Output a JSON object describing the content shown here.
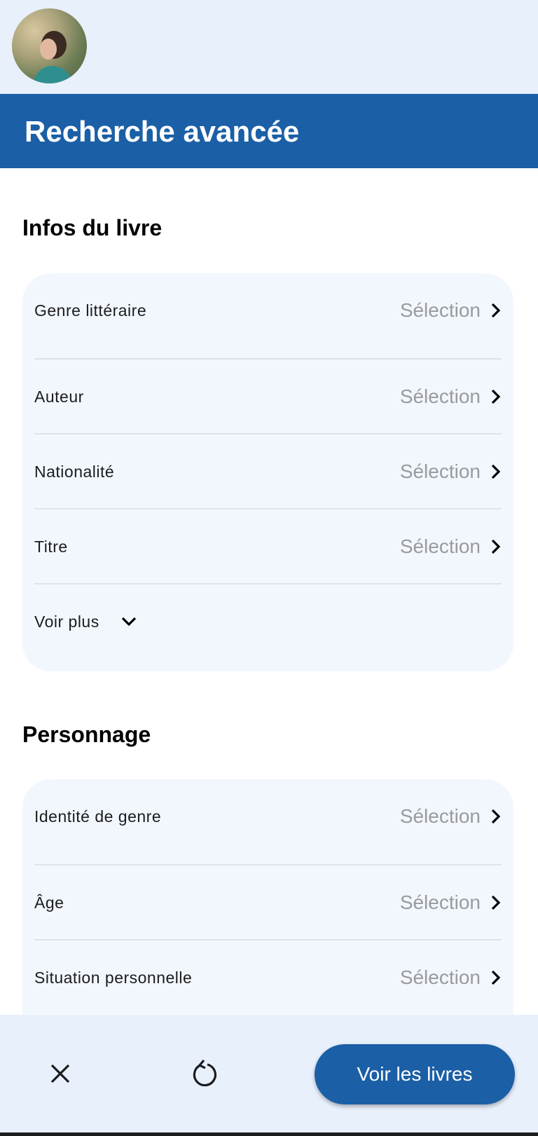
{
  "header": {
    "title": "Recherche avancée"
  },
  "avatar": {
    "alt": "user-avatar"
  },
  "sections": [
    {
      "title": "Infos du livre",
      "rows": [
        {
          "label": "Genre littéraire",
          "value": "Sélection"
        },
        {
          "label": "Auteur",
          "value": "Sélection"
        },
        {
          "label": "Nationalité",
          "value": "Sélection"
        },
        {
          "label": "Titre",
          "value": "Sélection"
        }
      ],
      "more_label": "Voir plus"
    },
    {
      "title": "Personnage",
      "rows": [
        {
          "label": "Identité de genre",
          "value": "Sélection"
        },
        {
          "label": "Âge",
          "value": "Sélection"
        },
        {
          "label": "Situation personnelle",
          "value": "Sélection"
        }
      ]
    }
  ],
  "bottom": {
    "close_icon": "close-icon",
    "reset_icon": "reset-icon",
    "cta_label": "Voir les livres"
  },
  "colors": {
    "brand": "#1b5fa6",
    "topbar": "#e8f0fc",
    "card": "#f2f7fe",
    "placeholder": "#9a9a9e"
  }
}
